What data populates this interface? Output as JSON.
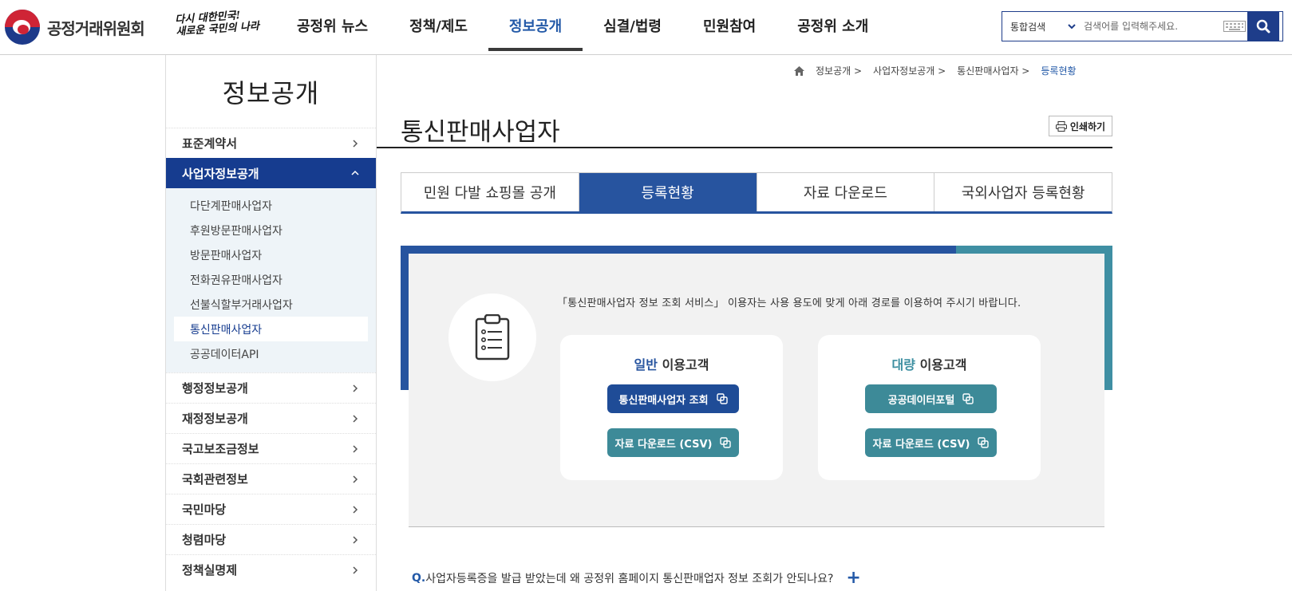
{
  "header": {
    "logo_text": "공정거래위원회",
    "slogan_line1": "다시 대한민국!",
    "slogan_line2": "새로운 국민의 나라",
    "nav": [
      "공정위 뉴스",
      "정책/제도",
      "정보공개",
      "심결/법령",
      "민원참여",
      "공정위 소개"
    ],
    "nav_active": "정보공개",
    "search": {
      "scope": "통합검색",
      "placeholder": "검색어를 입력해주세요."
    }
  },
  "sidebar": {
    "title": "정보공개",
    "items": [
      {
        "label": "표준계약서"
      },
      {
        "label": "사업자정보공개",
        "open": true
      },
      {
        "label": "행정정보공개"
      },
      {
        "label": "재정정보공개"
      },
      {
        "label": "국고보조금정보"
      },
      {
        "label": "국회관련정보"
      },
      {
        "label": "국민마당"
      },
      {
        "label": "청렴마당"
      },
      {
        "label": "정책실명제"
      }
    ],
    "sub_items": [
      "다단계판매사업자",
      "후원방문판매사업자",
      "방문판매사업자",
      "전화권유판매사업자",
      "선불식할부거래사업자",
      "통신판매사업자",
      "공공데이터API"
    ],
    "sub_current": "통신판매사업자"
  },
  "breadcrumb": [
    "정보공개",
    "사업자정보공개",
    "통신판매사업자",
    "등록현황"
  ],
  "page": {
    "title": "통신판매사업자",
    "print_label": "인쇄하기"
  },
  "tabs": [
    "민원 다발 쇼핑몰 공개",
    "등록현황",
    "자료 다운로드",
    "국외사업자 등록현황"
  ],
  "tab_active": "등록현황",
  "notice": "「통신판매사업자 정보 조회 서비스」 이용자는 사용 용도에 맞게 아래 경로를 이용하여 주시기 바랍니다.",
  "cards": [
    {
      "title_highlight": "일반",
      "title_rest": " 이용고객",
      "buttons": [
        "통신판매사업자 조회",
        "자료 다운로드 (CSV)"
      ]
    },
    {
      "title_highlight": "대량",
      "title_rest": " 이용고객",
      "buttons": [
        "공공데이터포털",
        "자료 다운로드 (CSV)"
      ]
    }
  ],
  "faq": {
    "q_mark": "Q.",
    "question": "사업자등록증을 발급 받았는데 왜 공정위 홈페이지 통신판매업자 정보 조회가 안되나요?",
    "toggle": "+"
  },
  "colors": {
    "primary": "#163c8f",
    "tab_blue": "#27549f",
    "teal": "#3d8a98"
  }
}
